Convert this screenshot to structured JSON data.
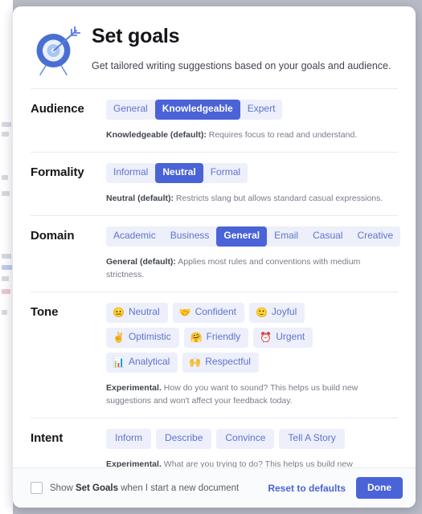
{
  "header": {
    "icon": "target-arrow-icon",
    "title": "Set goals",
    "subtitle": "Get tailored writing suggestions based on your goals and audience."
  },
  "colors": {
    "accent": "#4a63d7",
    "chip_bg": "#edeffb",
    "chip_text": "#5d75cd",
    "title": "#14161a",
    "hint": "#777c88",
    "footer_bg": "#fafbfd"
  },
  "sections": [
    {
      "label": "Audience",
      "type": "segmented",
      "options": [
        {
          "label": "General",
          "selected": false
        },
        {
          "label": "Knowledgeable",
          "selected": true
        },
        {
          "label": "Expert",
          "selected": false
        }
      ],
      "hint_strong": "Knowledgeable (default):",
      "hint_rest": " Requires focus to read and understand."
    },
    {
      "label": "Formality",
      "type": "segmented",
      "options": [
        {
          "label": "Informal",
          "selected": false
        },
        {
          "label": "Neutral",
          "selected": true
        },
        {
          "label": "Formal",
          "selected": false
        }
      ],
      "hint_strong": "Neutral (default):",
      "hint_rest": " Restricts slang but allows standard casual expressions."
    },
    {
      "label": "Domain",
      "type": "segmented",
      "options": [
        {
          "label": "Academic",
          "selected": false
        },
        {
          "label": "Business",
          "selected": false
        },
        {
          "label": "General",
          "selected": true
        },
        {
          "label": "Email",
          "selected": false
        },
        {
          "label": "Casual",
          "selected": false
        },
        {
          "label": "Creative",
          "selected": false
        }
      ],
      "hint_strong": "General (default):",
      "hint_rest": " Applies most rules and conventions with medium strictness."
    },
    {
      "label": "Tone",
      "type": "chips-emoji",
      "options": [
        {
          "label": "Neutral",
          "emoji": "😐",
          "emoji_name": "neutral-face-emoji",
          "selected": false
        },
        {
          "label": "Confident",
          "emoji": "🤝",
          "emoji_name": "handshake-emoji",
          "selected": false
        },
        {
          "label": "Joyful",
          "emoji": "🙂",
          "emoji_name": "slightly-smiling-face-emoji",
          "selected": false
        },
        {
          "label": "Optimistic",
          "emoji": "✌️",
          "emoji_name": "victory-hand-emoji",
          "selected": false
        },
        {
          "label": "Friendly",
          "emoji": "🤗",
          "emoji_name": "hugging-face-emoji",
          "selected": false
        },
        {
          "label": "Urgent",
          "emoji": "⏰",
          "emoji_name": "alarm-clock-emoji",
          "selected": false
        },
        {
          "label": "Analytical",
          "emoji": "📊",
          "emoji_name": "bar-chart-emoji",
          "selected": false
        },
        {
          "label": "Respectful",
          "emoji": "🙌",
          "emoji_name": "raising-hands-emoji",
          "selected": false
        }
      ],
      "hint_strong": "Experimental.",
      "hint_rest": " How do you want to sound? This helps us build new suggestions and won't affect your feedback today."
    },
    {
      "label": "Intent",
      "type": "chips-plain",
      "options": [
        {
          "label": "Inform",
          "selected": false
        },
        {
          "label": "Describe",
          "selected": false
        },
        {
          "label": "Convince",
          "selected": false
        },
        {
          "label": "Tell A Story",
          "selected": false
        }
      ],
      "hint_strong": "Experimental.",
      "hint_rest": " What are you trying to do? This helps us build new suggestions and won't affect your feedback today."
    }
  ],
  "footer": {
    "checkbox_checked": false,
    "checkbox_label_pre": "Show ",
    "checkbox_label_strong": "Set Goals",
    "checkbox_label_post": " when I start a new document",
    "reset_label": "Reset to defaults",
    "done_label": "Done"
  }
}
